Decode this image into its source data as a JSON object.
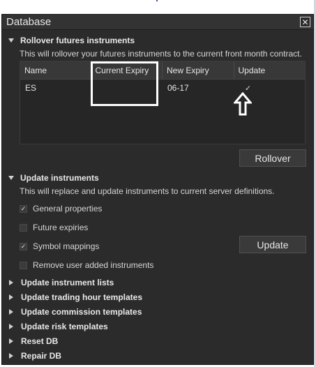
{
  "dialog": {
    "title": "Database",
    "close_glyph": "✕"
  },
  "rollover": {
    "header": "Rollover futures instruments",
    "description": "This will rollover your futures instruments to the current front month contract.",
    "columns": [
      "Name",
      "Current Expiry",
      "New Expiry",
      "Update"
    ],
    "rows": [
      {
        "name": "ES",
        "current_expiry": "",
        "new_expiry": "06-17",
        "update_checked": true
      }
    ],
    "button_label": "Rollover"
  },
  "update_instruments": {
    "header": "Update instruments",
    "description": "This will replace and update instruments to current server definitions.",
    "options": [
      {
        "label": "General properties",
        "checked": true
      },
      {
        "label": "Future expiries",
        "checked": false
      },
      {
        "label": "Symbol mappings",
        "checked": true
      },
      {
        "label": "Remove user added instruments",
        "checked": false
      }
    ],
    "button_label": "Update"
  },
  "collapsed_sections": [
    "Update instrument lists",
    "Update trading hour templates",
    "Update commission templates",
    "Update risk templates",
    "Reset DB",
    "Repair DB"
  ],
  "glyphs": {
    "check": "✓"
  },
  "colors": {
    "dialog_bg": "#2b2b2b",
    "grid_header_bg": "#383838",
    "text": "#e6e6e6",
    "annotation": "#ffffff"
  }
}
